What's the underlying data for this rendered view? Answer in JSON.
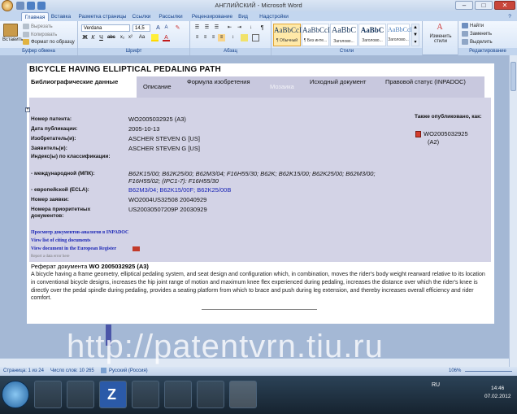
{
  "window": {
    "title": "АНГЛИЙСКИЙ - Microsoft Word",
    "controls": {
      "minimize": "–",
      "maximize": "□",
      "close": "✕"
    },
    "help": "?"
  },
  "ribbon_tabs": [
    "Главная",
    "Вставка",
    "Разметка страницы",
    "Ссылки",
    "Рассылки",
    "Рецензирование",
    "Вид",
    "Надстройки"
  ],
  "ribbon": {
    "clipboard": {
      "paste": "Вставить",
      "cut": "Вырезать",
      "copy": "Копировать",
      "format": "Формат по образцу",
      "group": "Буфер обмена"
    },
    "font": {
      "name": "Verdana",
      "size": "14,5",
      "group": "Шрифт",
      "bold": "Ж",
      "italic": "К",
      "underline": "Ч",
      "color": "А"
    },
    "paragraph": {
      "group": "Абзац"
    },
    "styles": {
      "items": [
        {
          "sample": "AaBbCcI",
          "name": "¶ Обычный"
        },
        {
          "sample": "AaBbCcI",
          "name": "¶ Без инте..."
        },
        {
          "sample": "AaBbC",
          "name": "Заголово..."
        },
        {
          "sample": "AaBbC",
          "name": "Заголово..."
        },
        {
          "sample": "AaBbCcI",
          "name": "Заголово..."
        }
      ],
      "change": "Изменить стили",
      "group": "Стили"
    },
    "editing": {
      "find": "Найти",
      "replace": "Заменить",
      "select": "Выделить",
      "group": "Редактирование"
    }
  },
  "patent": {
    "title": "BICYCLE HAVING ELLIPTICAL PEDALING PATH",
    "tabs": [
      {
        "label": "Библиографические данные"
      },
      {
        "label": "Описание"
      },
      {
        "label": "Формула изобретения"
      },
      {
        "label": "Мозаика"
      },
      {
        "label": "Исходный документ"
      },
      {
        "label": "Правовой статус (INPADOC)"
      }
    ],
    "fields": {
      "patent_no": {
        "label": "Номер патента:",
        "value": "WO2005032925  (A3)"
      },
      "pub_date": {
        "label": "Дата публикации:",
        "value": "2005-10-13"
      },
      "inventors": {
        "label": "Изобретатель(и):",
        "value": "ASCHER STEVEN G [US]"
      },
      "applicants": {
        "label": "Заявитель(и):",
        "value": "ASCHER STEVEN G [US]"
      },
      "index": {
        "label": "Индекс(ы) по классификации:"
      },
      "ipc": {
        "label": "- международной  (МПК):",
        "value": "B62K15/00; B62K25/00; B62M3/04; F16H55/30; B62K; B62K15/00; B62K25/00; B62M3/00; F16H55/02;  (IPC1-7): F16H55/30"
      },
      "ecla": {
        "label": "- европейской  (ECLA):",
        "value": "B62M3/04; B62K15/00F; B62K25/00B"
      },
      "app_no": {
        "label": "Номер заявки:",
        "value": "WO2004US32508  20040929"
      },
      "priority": {
        "label": "Номера приоритетных документов:",
        "value": "US20030507209P  20030929"
      }
    },
    "also_published_label": "Также опубликовано, как:",
    "also_published": [
      "WO2005032925",
      "(A2)"
    ],
    "links": [
      "Просмотр документов-аналогов в INPADOC",
      "View list of citing documents",
      "View document in the European Register"
    ],
    "report_error": "Report a data error here",
    "abstract_heading": "Реферат документа",
    "abstract_doc": "WO 2005032925  (A3)",
    "abstract": "A bicycle having a frame geometry, elliptical pedaling system, and seat design and configuration which, in combination,  moves the rider's body weight rearward relative to its location in conventional bicycle designs, increases the hip joint range of motion and maximum knee flex experienced during pedaling, increases the distance over which the rider's knee is directly over the pedal spindle during pedaling, provides a seating platform from which to brace and push during leg extension, and thereby increases overall efficiency and rider comfort."
  },
  "status_bar": {
    "page": "Страница: 1 из 24",
    "words": "Число слов: 10 265",
    "language": "Русский (Россия)",
    "zoom": "106%"
  },
  "taskbar": {
    "lang": "RU",
    "time": "14:46",
    "date": "07.02.2012"
  },
  "watermark": "http://patentvrn.tiu.ru",
  "colors": {
    "ribbon_text": "#15428b",
    "link": "#1a25b5",
    "patent_bg": "#d3d3e6",
    "doc_bg": "#a4b8d5"
  }
}
